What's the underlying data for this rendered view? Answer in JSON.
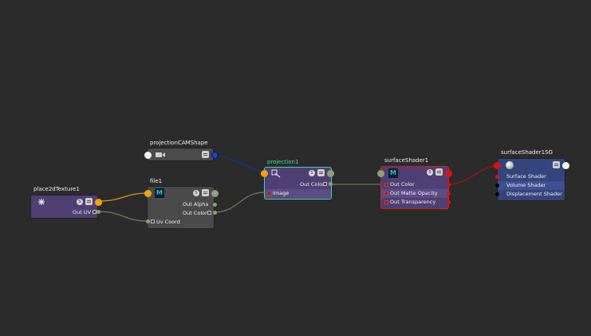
{
  "nodes": {
    "projection_cam": {
      "title": "projectionCAMShape"
    },
    "place2d": {
      "title": "place2dTexture1",
      "out_uv": "Out UV"
    },
    "file1": {
      "title": "file1",
      "out_alpha": "Out Alpha",
      "out_color": "Out Color",
      "uv_coord": "Uv Coord",
      "icon_letter": "M"
    },
    "projection1": {
      "title": "projection1",
      "out_color": "Out Color",
      "image": "Image"
    },
    "surface_shader": {
      "title": "surfaceShader1",
      "out_color": "Out Color",
      "out_matte": "Out Matte Opacity",
      "out_transparency": "Out Transparency",
      "icon_letter": "M"
    },
    "shading_group": {
      "title": "surfaceShader1SG",
      "surface_shader": "Surface Shader",
      "volume_shader": "Volume Shader",
      "displacement_shader": "Displacement Shader"
    }
  },
  "colors": {
    "background": "#2b2b2b",
    "texture_node": "#4f3f74",
    "utility_node": "#4a4a4a",
    "shading_group_node": "#34447c",
    "selected_outline_green": "#3fd8a8",
    "selected_outline_red": "#e01818",
    "edge_gray": "#6e7a5e",
    "edge_orange": "#d29a10",
    "edge_blue": "#1c2e8c",
    "edge_red": "#b01010"
  }
}
